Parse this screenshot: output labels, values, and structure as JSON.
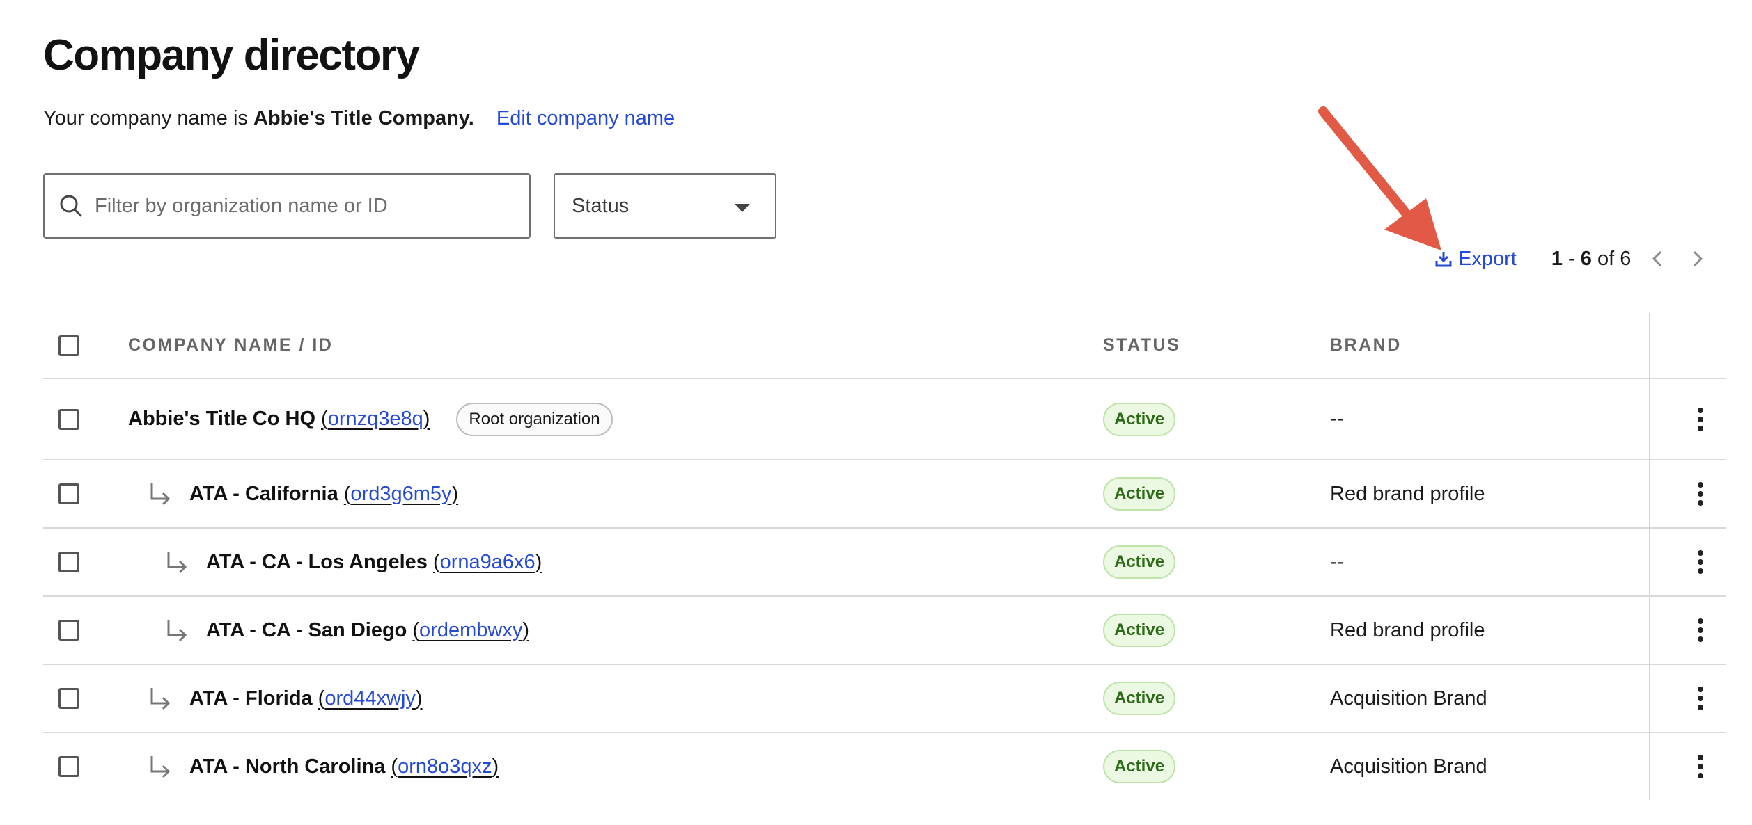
{
  "page": {
    "title": "Company directory",
    "company_prefix": "Your company name is",
    "company_name": "Abbie's Title Company.",
    "edit_link": "Edit company name"
  },
  "filters": {
    "search_placeholder": "Filter by organization name or ID",
    "search_value": "",
    "status_label": "Status"
  },
  "toolbar": {
    "export_label": "Export",
    "range_start": "1",
    "range_sep": "-",
    "range_end": "6",
    "of_label": "of 6"
  },
  "table": {
    "headers": {
      "name": "COMPANY NAME / ID",
      "status": "STATUS",
      "brand": "BRAND"
    },
    "rows": [
      {
        "name": "Abbie's Title Co HQ",
        "id": "ornzq3e8q",
        "badge": "Root organization",
        "status": "Active",
        "brand": "--",
        "level": 0
      },
      {
        "name": "ATA - California",
        "id": "ord3g6m5y",
        "status": "Active",
        "brand": "Red brand profile",
        "level": 1
      },
      {
        "name": "ATA - CA - Los Angeles",
        "id": "orna9a6x6",
        "status": "Active",
        "brand": "--",
        "level": 2
      },
      {
        "name": "ATA - CA - San Diego",
        "id": "ordembwxy",
        "status": "Active",
        "brand": "Red brand profile",
        "level": 2
      },
      {
        "name": "ATA - Florida",
        "id": "ord44xwjy",
        "status": "Active",
        "brand": "Acquisition Brand",
        "level": 1
      },
      {
        "name": "ATA - North Carolina",
        "id": "orn8o3qxz",
        "status": "Active",
        "brand": "Acquisition Brand",
        "level": 1
      }
    ]
  },
  "icons": {
    "search": "search-icon",
    "dropdown": "caret-down-icon",
    "export": "download-icon",
    "prev": "chevron-left-icon",
    "next": "chevron-right-icon",
    "child": "child-arrow-icon",
    "more": "more-vertical-icon",
    "annotation": "red-arrow-annotation"
  },
  "colors": {
    "link": "#2449d6",
    "active_bg": "#ecf9e2",
    "active_text": "#2f6a1a",
    "annotation_arrow": "#e25a45"
  }
}
